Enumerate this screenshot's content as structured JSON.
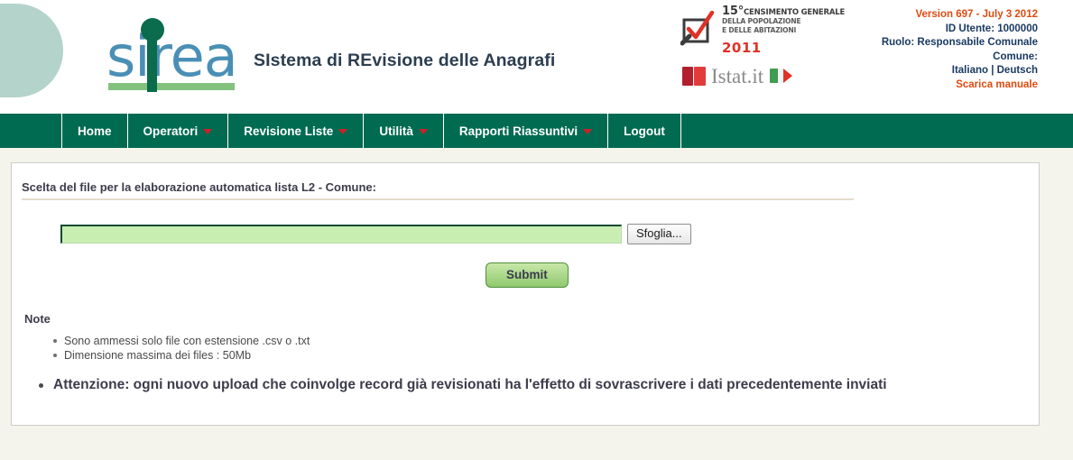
{
  "header": {
    "logo_text": "sirea",
    "app_title": "SIstema di REvisione delle Anagrafi",
    "census": {
      "number": "15°",
      "line1": "CENSIMENTO GENERALE",
      "line2": "DELLA POPOLAZIONE",
      "line3": "E DELLE ABITAZIONI",
      "year": "2011"
    },
    "istat": {
      "word": "Istat.it"
    },
    "user_info": {
      "version": "Version 697 - July 3 2012",
      "user_id": "ID Utente: 1000000",
      "role": "Ruolo: Responsabile Comunale",
      "comune": "Comune:",
      "languages": "Italiano | Deutsch",
      "manual_link": "Scarica manuale"
    },
    "colors": {
      "accent_orange": "#e04a10",
      "info_blue": "#1a3a63",
      "nav_green": "#006b51",
      "caret_red": "#cf2027",
      "logo_blue": "#4a8fb5",
      "logo_green": "#0a6b4d",
      "logo_bar_green": "#82c27c",
      "deco_teal": "#b3d3cb",
      "page_bg": "#f4f4ec",
      "input_green": "#c9eeb1"
    }
  },
  "nav": {
    "items": [
      {
        "label": "Home",
        "has_caret": false
      },
      {
        "label": "Operatori",
        "has_caret": true
      },
      {
        "label": "Revisione Liste",
        "has_caret": true
      },
      {
        "label": "Utilità",
        "has_caret": true
      },
      {
        "label": "Rapporti Riassuntivi",
        "has_caret": true
      },
      {
        "label": "Logout",
        "has_caret": false
      }
    ]
  },
  "main": {
    "section_title": "Scelta del file per la elaborazione automatica lista L2 - Comune:",
    "file_input_value": "",
    "file_input_placeholder": "",
    "browse_label": "Sfoglia...",
    "submit_label": "Submit",
    "notes_title": "Note",
    "notes": [
      "Sono ammessi solo file con estensione .csv o .txt",
      "Dimensione massima dei files : 50Mb"
    ],
    "warning": "Attenzione: ogni nuovo upload che coinvolge record già revisionati ha l'effetto di sovrascrivere i dati precedentemente inviati"
  }
}
